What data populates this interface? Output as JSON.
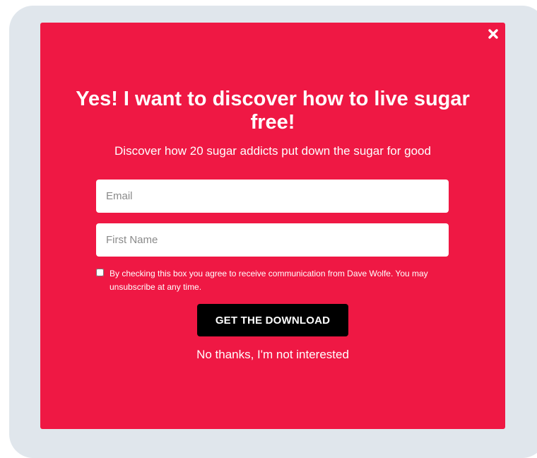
{
  "popup": {
    "headline": "Yes! I want to discover how to live sugar free!",
    "subheadline": "Discover how 20 sugar addicts put down the sugar for good",
    "close_icon": "close-x-icon",
    "background_color": "#ef1844"
  },
  "form": {
    "email": {
      "placeholder": "Email",
      "value": ""
    },
    "first_name": {
      "placeholder": "First Name",
      "value": ""
    },
    "consent": {
      "checked": false,
      "text": "By checking this box you agree to receive communication from Dave Wolfe. You may unsubscribe at any time."
    },
    "submit_label": "GET THE DOWNLOAD",
    "dismiss_label": "No thanks, I'm not interested"
  }
}
